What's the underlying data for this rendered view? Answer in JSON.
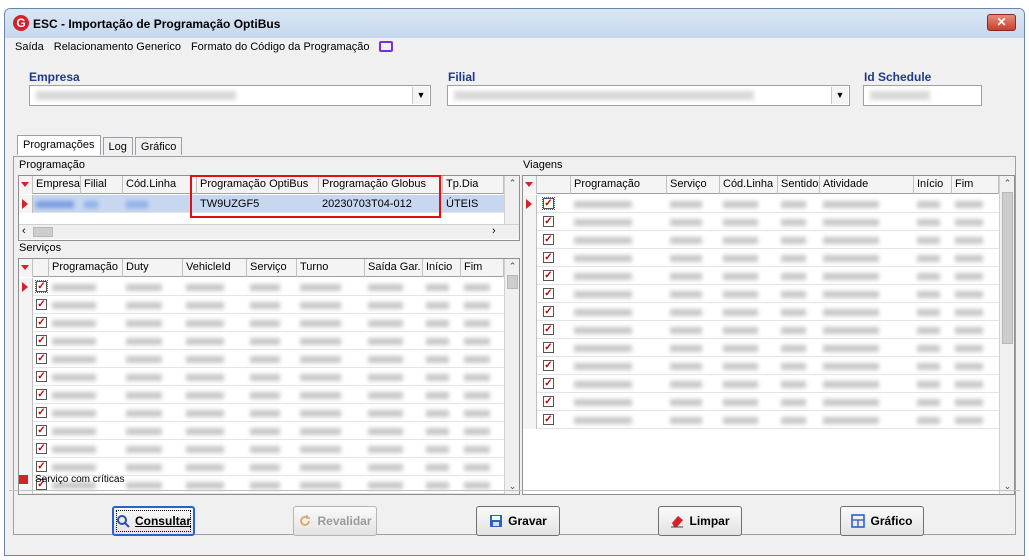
{
  "window": {
    "title": "ESC - Importação de Programação OptiBus",
    "close_label": "✕"
  },
  "menu": {
    "items": [
      "Saída",
      "Relacionamento Generico",
      "Formato do Código da Programação"
    ]
  },
  "fields": {
    "empresa_label": "Empresa",
    "filial_label": "Filial",
    "id_schedule_label": "Id Schedule"
  },
  "tabs": [
    "Programações",
    "Log",
    "Gráfico"
  ],
  "programacao": {
    "section_label": "Programação",
    "columns": [
      "Empresa",
      "Filial",
      "Cód.Linha",
      "Programação OptiBus",
      "Programação Globus",
      "Tp.Dia"
    ],
    "row": {
      "prog_optibus": "TW9UZGF5",
      "prog_globus": "20230703T04-012",
      "tp_dia": "ÚTEIS"
    }
  },
  "servicos": {
    "section_label": "Serviços",
    "columns": [
      "Programação",
      "Duty",
      "VehicleId",
      "Serviço",
      "Turno",
      "Saída Gar.",
      "Início",
      "Fim"
    ],
    "row_count": 12
  },
  "viagens": {
    "section_label": "Viagens",
    "columns": [
      "Programação",
      "Serviço",
      "Cód.Linha",
      "Sentido",
      "Atividade",
      "Início",
      "Fim"
    ],
    "row_count": 13
  },
  "legend": {
    "text": "Serviço com críticas",
    "color": "#d6202a"
  },
  "buttons": {
    "consultar": "Consultar",
    "revalidar": "Revalidar",
    "gravar": "Gravar",
    "limpar": "Limpar",
    "grafico": "Gráfico"
  },
  "colors": {
    "accent": "#d6202a",
    "label_blue": "#1f3a8a",
    "highlight": "#e01010",
    "selection": "#c7d7f0"
  }
}
